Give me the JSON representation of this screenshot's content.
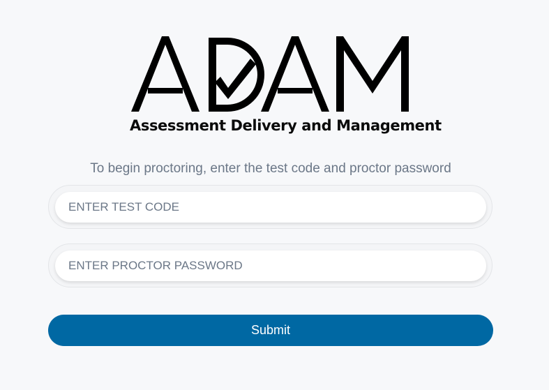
{
  "logo": {
    "wordmark": "ADAM",
    "subtitle": "Assessment Delivery and Management"
  },
  "instruction": "To begin proctoring, enter the test code and proctor password",
  "form": {
    "test_code": {
      "value": "",
      "placeholder": "ENTER TEST CODE"
    },
    "proctor_password": {
      "value": "",
      "placeholder": "ENTER PROCTOR PASSWORD"
    },
    "submit_label": "Submit"
  },
  "colors": {
    "background": "#f7f8fa",
    "accent": "#0068a3",
    "muted_text": "#6b7787"
  }
}
